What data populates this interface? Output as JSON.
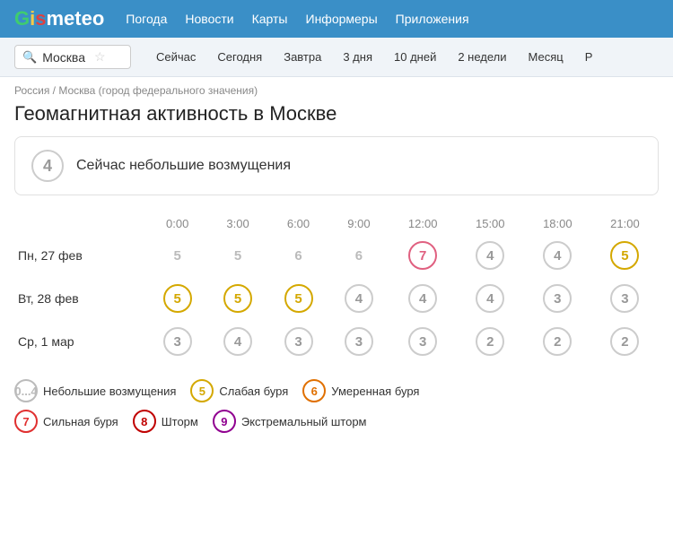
{
  "header": {
    "logo_gis": "GIS",
    "logo_meteo": "meteo",
    "nav": [
      "Погода",
      "Новости",
      "Карты",
      "Информеры",
      "Приложения"
    ]
  },
  "search": {
    "city": "Москва",
    "tabs": [
      "Сейчас",
      "Сегодня",
      "Завтра",
      "3 дня",
      "10 дней",
      "2 недели",
      "Месяц",
      "P"
    ]
  },
  "breadcrumb": "Россия / Москва (город федерального значения)",
  "page_title": "Геомагнитная активность в Москве",
  "current_status": {
    "value": "4",
    "text": "Сейчас небольшие возмущения"
  },
  "table": {
    "headers": [
      "",
      "0:00",
      "3:00",
      "6:00",
      "9:00",
      "12:00",
      "15:00",
      "18:00",
      "21:00"
    ],
    "rows": [
      {
        "label": "Пн, 27 фев",
        "values": [
          {
            "val": "5",
            "style": "gray"
          },
          {
            "val": "5",
            "style": "gray"
          },
          {
            "val": "6",
            "style": "gray"
          },
          {
            "val": "6",
            "style": "gray"
          },
          {
            "val": "7",
            "style": "pink"
          },
          {
            "val": "4",
            "style": "white"
          },
          {
            "val": "4",
            "style": "white"
          },
          {
            "val": "5",
            "style": "yellow"
          }
        ]
      },
      {
        "label": "Вт, 28 фев",
        "values": [
          {
            "val": "5",
            "style": "yellow"
          },
          {
            "val": "5",
            "style": "yellow"
          },
          {
            "val": "5",
            "style": "yellow"
          },
          {
            "val": "4",
            "style": "white"
          },
          {
            "val": "4",
            "style": "white"
          },
          {
            "val": "4",
            "style": "white"
          },
          {
            "val": "3",
            "style": "white"
          },
          {
            "val": "3",
            "style": "white"
          }
        ]
      },
      {
        "label": "Ср, 1 мар",
        "values": [
          {
            "val": "3",
            "style": "white"
          },
          {
            "val": "4",
            "style": "white"
          },
          {
            "val": "3",
            "style": "white"
          },
          {
            "val": "3",
            "style": "white"
          },
          {
            "val": "3",
            "style": "white"
          },
          {
            "val": "2",
            "style": "white"
          },
          {
            "val": "2",
            "style": "white"
          },
          {
            "val": "2",
            "style": "white"
          }
        ]
      }
    ]
  },
  "legend": {
    "row1": [
      {
        "value": "0...4",
        "style": "gray",
        "label": "Небольшие возмущения"
      },
      {
        "value": "5",
        "style": "yellow",
        "label": "Слабая буря"
      },
      {
        "value": "6",
        "style": "orange",
        "label": "Умеренная буря"
      }
    ],
    "row2": [
      {
        "value": "7",
        "style": "red",
        "label": "Сильная буря"
      },
      {
        "value": "8",
        "style": "darkred",
        "label": "Шторм"
      },
      {
        "value": "9",
        "style": "purple",
        "label": "Экстремальный шторм"
      }
    ]
  }
}
